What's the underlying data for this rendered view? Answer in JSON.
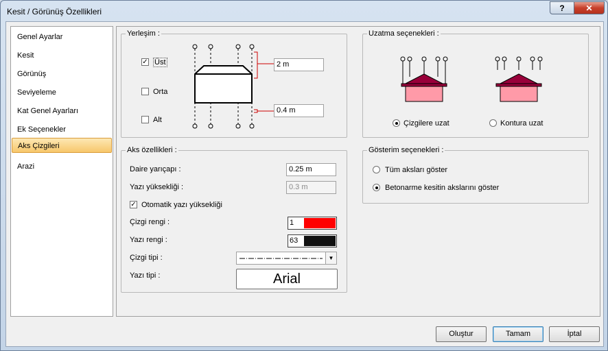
{
  "window": {
    "title": "Kesit / Görünüş Özellikleri",
    "help_label": "?",
    "close_label": "✕"
  },
  "sidebar": {
    "items": [
      {
        "label": "Genel Ayarlar"
      },
      {
        "label": "Kesit"
      },
      {
        "label": "Görünüş"
      },
      {
        "label": "Seviyeleme"
      },
      {
        "label": "Kat Genel Ayarları"
      },
      {
        "label": "Ek Seçenekler"
      },
      {
        "label": "Aks Çizgileri",
        "active": true
      },
      {
        "label": "Arazi"
      }
    ]
  },
  "placement": {
    "legend": "Yerleşim :",
    "top_label": "Üst",
    "top_checked": true,
    "middle_label": "Orta",
    "middle_checked": false,
    "bottom_label": "Alt",
    "bottom_checked": false,
    "top_value": "2 m",
    "bottom_value": "0.4 m"
  },
  "extension": {
    "legend": "Uzatma seçenekleri :",
    "option_lines": "Çizgilere uzat",
    "option_contour": "Kontura uzat",
    "selected": "lines"
  },
  "display": {
    "legend": "Gösterim seçenekleri :",
    "option_all": "Tüm aksları göster",
    "option_concrete": "Betonarme kesitin akslarını göster",
    "selected": "concrete"
  },
  "axis": {
    "legend": "Aks özellikleri :",
    "circle_radius_label": "Daire yarıçapı :",
    "circle_radius_value": "0.25 m",
    "text_height_label": "Yazı yüksekliği :",
    "text_height_value": "0.3 m",
    "auto_text_height_label": "Otomatik yazı yüksekliği",
    "auto_text_height_checked": true,
    "line_color_label": "Çizgi rengi :",
    "line_color_index": "1",
    "line_color": "#ff0000",
    "text_color_label": "Yazı rengi :",
    "text_color_index": "63",
    "text_color": "#111111",
    "line_type_label": "Çizgi tipi :",
    "line_type_icon": "dash-dot-line",
    "font_label": "Yazı tipi :",
    "font_name": "Arial"
  },
  "buttons": {
    "create": "Oluştur",
    "ok": "Tamam",
    "cancel": "İptal"
  },
  "colors": {
    "roof": "#99003a",
    "wall": "#ff9aa8",
    "marker": "#cc0000"
  }
}
